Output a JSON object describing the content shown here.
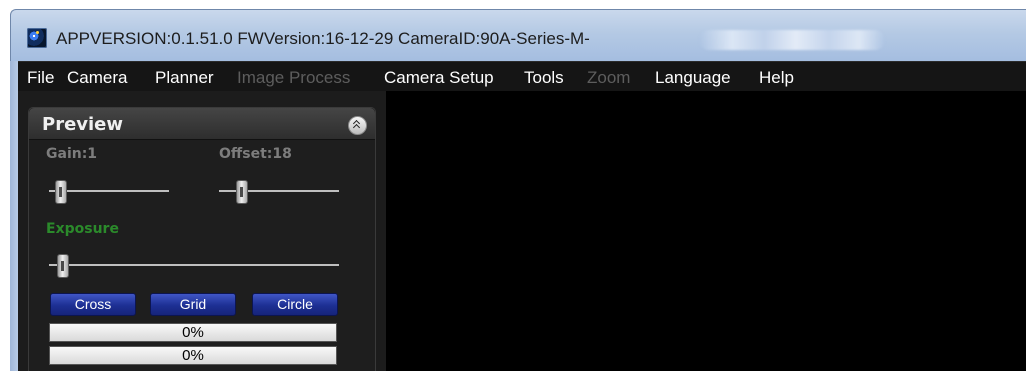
{
  "window": {
    "title": "APPVERSION:0.1.51.0  FWVersion:16-12-29  CameraID:90A-Series-M-",
    "icon": "astro-app-icon"
  },
  "menu": [
    {
      "label": "File",
      "enabled": true
    },
    {
      "label": "Camera",
      "enabled": true
    },
    {
      "label": "Planner",
      "enabled": true
    },
    {
      "label": "Image Process",
      "enabled": false
    },
    {
      "label": "Camera Setup",
      "enabled": true
    },
    {
      "label": "Tools",
      "enabled": true
    },
    {
      "label": "Zoom",
      "enabled": false
    },
    {
      "label": "Language",
      "enabled": true
    },
    {
      "label": "Help",
      "enabled": true
    }
  ],
  "preview": {
    "title": "Preview",
    "collapse_icon": "double-chevron-up-icon",
    "gain": {
      "label": "Gain:1",
      "value": 1,
      "level": 0.05
    },
    "offset": {
      "label": "Offset:18",
      "value": 18,
      "level": 0.15
    },
    "exposure": {
      "label": "Exposure",
      "level": 0.03
    },
    "buttons": {
      "cross": "Cross",
      "grid": "Grid",
      "circle": "Circle"
    },
    "progress": [
      {
        "text": "0%",
        "value": 0
      },
      {
        "text": "0%",
        "value": 0
      }
    ]
  },
  "colors": {
    "menubar": "#151515",
    "viewport": "#000000",
    "button_blue": "#1d2f93",
    "exposure_label": "#2b8a2b",
    "disabled_menu": "#5d5d5d"
  }
}
